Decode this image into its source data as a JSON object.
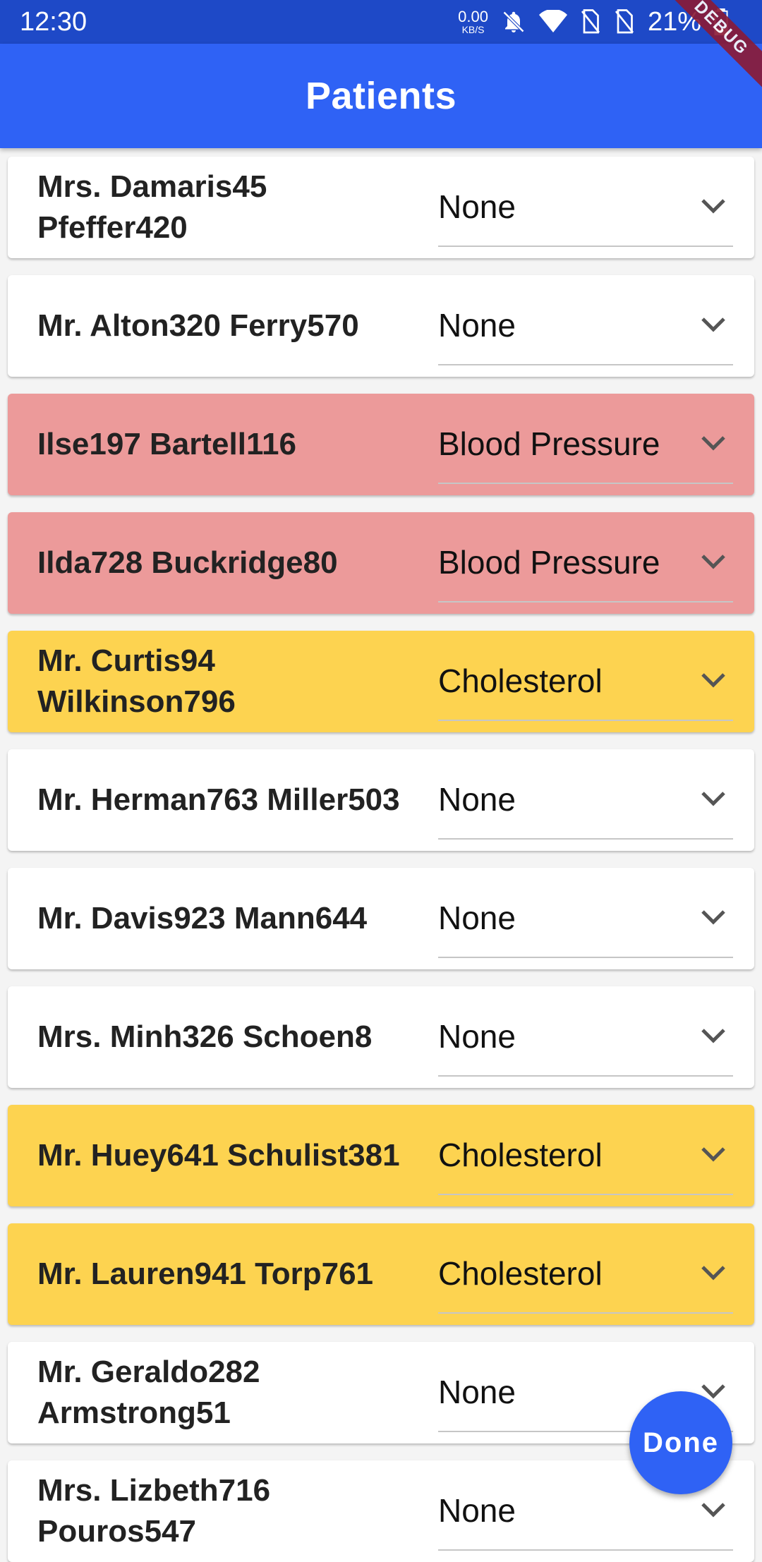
{
  "status_bar": {
    "time": "12:30",
    "net_speed": "0.00",
    "net_unit": "KB/S",
    "battery": "21%",
    "icons": [
      "bell-off-icon",
      "wifi-icon",
      "no-sim-icon",
      "no-sim-icon",
      "battery-icon"
    ]
  },
  "debug_banner": "DEBUG",
  "appbar": {
    "title": "Patients"
  },
  "patients": [
    {
      "name": "Mrs. Damaris45 Pfeffer420",
      "condition": "None",
      "color": "#ffffff"
    },
    {
      "name": "Mr. Alton320 Ferry570",
      "condition": "None",
      "color": "#ffffff"
    },
    {
      "name": "Ilse197 Bartell116",
      "condition": "Blood Pressure",
      "color": "#ec9a9a"
    },
    {
      "name": "Ilda728 Buckridge80",
      "condition": "Blood Pressure",
      "color": "#ec9a9a"
    },
    {
      "name": "Mr. Curtis94 Wilkinson796",
      "condition": "Cholesterol",
      "color": "#fdd350"
    },
    {
      "name": "Mr. Herman763 Miller503",
      "condition": "None",
      "color": "#ffffff"
    },
    {
      "name": "Mr. Davis923 Mann644",
      "condition": "None",
      "color": "#ffffff"
    },
    {
      "name": "Mrs. Minh326 Schoen8",
      "condition": "None",
      "color": "#ffffff"
    },
    {
      "name": "Mr. Huey641 Schulist381",
      "condition": "Cholesterol",
      "color": "#fdd350"
    },
    {
      "name": "Mr. Lauren941 Torp761",
      "condition": "Cholesterol",
      "color": "#fdd350"
    },
    {
      "name": "Mr. Geraldo282 Armstrong51",
      "condition": "None",
      "color": "#ffffff"
    },
    {
      "name": "Mrs. Lizbeth716 Pouros547",
      "condition": "None",
      "color": "#ffffff"
    }
  ],
  "fab": {
    "label": "Done"
  },
  "colors": {
    "status_bar": "#1e49c7",
    "app_bar": "#2f62f5",
    "blood_pressure": "#ec9a9a",
    "cholesterol": "#fdd350"
  }
}
